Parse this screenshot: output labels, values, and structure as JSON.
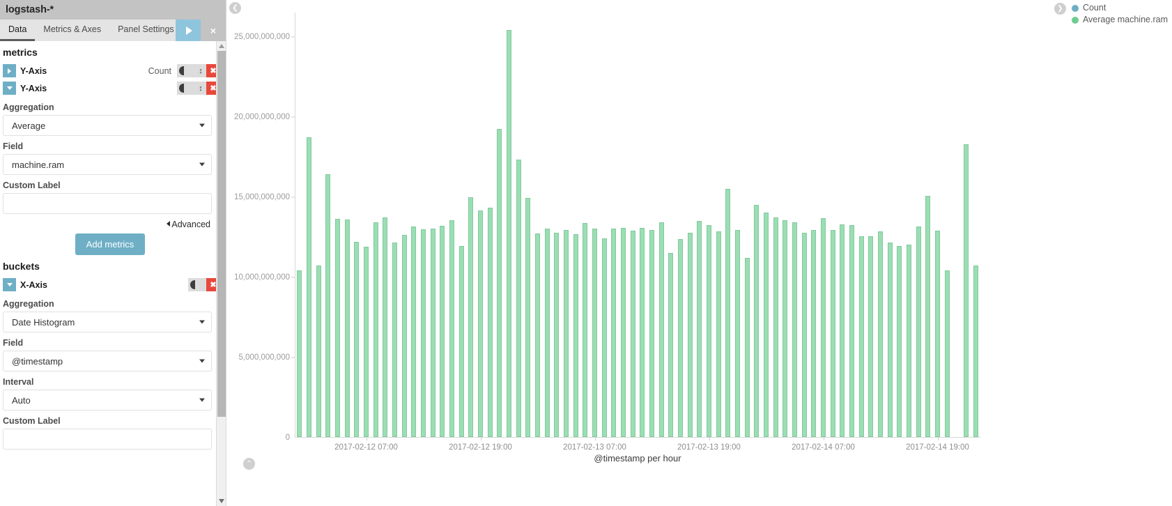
{
  "sidebar": {
    "title": "logstash-*",
    "tabs": [
      {
        "label": "Data",
        "active": true
      },
      {
        "label": "Metrics & Axes",
        "active": false
      },
      {
        "label": "Panel Settings",
        "active": false
      }
    ],
    "apply_icon": "play-icon",
    "discard_icon": "close-icon",
    "discard_label": "×",
    "metrics_heading": "metrics",
    "metrics": [
      {
        "name": "Y-Axis",
        "summary": "Count",
        "collapsed": true,
        "toggle_icon": "visibility-toggle",
        "drag_icon": "drag-handle-icon",
        "remove_icon": "remove-icon",
        "remove_label": "✖"
      },
      {
        "name": "Y-Axis",
        "summary": "",
        "collapsed": false,
        "toggle_icon": "visibility-toggle",
        "drag_icon": "drag-handle-icon",
        "remove_icon": "remove-icon",
        "remove_label": "✖",
        "aggregation_label": "Aggregation",
        "aggregation_value": "Average",
        "field_label": "Field",
        "field_value": "machine.ram",
        "custom_label_label": "Custom Label",
        "custom_label_value": "",
        "advanced_label": "Advanced"
      }
    ],
    "add_metrics_label": "Add metrics",
    "buckets_heading": "buckets",
    "buckets": [
      {
        "name": "X-Axis",
        "collapsed": false,
        "toggle_icon": "visibility-toggle",
        "remove_icon": "remove-icon",
        "remove_label": "✖",
        "aggregation_label": "Aggregation",
        "aggregation_value": "Date Histogram",
        "field_label": "Field",
        "field_value": "@timestamp",
        "interval_label": "Interval",
        "interval_value": "Auto",
        "custom_label_label": "Custom Label",
        "custom_label_value": ""
      }
    ],
    "scrollbar": {
      "up_icon": "scroll-up-arrow",
      "down_icon": "scroll-down-arrow"
    }
  },
  "chart_panel": {
    "collapse_left_icon": "chevron-left-icon",
    "collapse_left_glyph": "❮",
    "collapse_bottom_icon": "chevron-up-icon",
    "collapse_bottom_glyph": "⌃",
    "legend_toggle_icon": "chevron-right-icon",
    "legend_toggle_glyph": "❯"
  },
  "chart_data": {
    "type": "bar",
    "title": "",
    "xlabel": "@timestamp per hour",
    "ylabel": "",
    "ylim": [
      0,
      26500000000
    ],
    "grid": false,
    "legend_position": "top-right",
    "y_ticks": [
      {
        "value": 0,
        "label": "0"
      },
      {
        "value": 5000000000,
        "label": "5,000,000,000"
      },
      {
        "value": 10000000000,
        "label": "10,000,000,000"
      },
      {
        "value": 15000000000,
        "label": "15,000,000,000"
      },
      {
        "value": 20000000000,
        "label": "20,000,000,000"
      },
      {
        "value": 25000000000,
        "label": "25,000,000,000"
      }
    ],
    "x_ticks": [
      {
        "index": 7,
        "label": "2017-02-12 07:00"
      },
      {
        "index": 19,
        "label": "2017-02-12 19:00"
      },
      {
        "index": 31,
        "label": "2017-02-13 07:00"
      },
      {
        "index": 43,
        "label": "2017-02-13 19:00"
      },
      {
        "index": 55,
        "label": "2017-02-14 07:00"
      },
      {
        "index": 67,
        "label": "2017-02-14 19:00"
      }
    ],
    "legend": [
      {
        "name": "Count",
        "color": "#6eafc6"
      },
      {
        "name": "Average machine.ram",
        "color": "#6ecd8f"
      }
    ],
    "series": [
      {
        "name": "Average machine.ram",
        "color": "#7fd6a0",
        "values": [
          10400000000,
          18700000000,
          10700000000,
          16400000000,
          13600000000,
          13550000000,
          12150000000,
          11850000000,
          13400000000,
          13700000000,
          12100000000,
          12600000000,
          13100000000,
          12950000000,
          13000000000,
          13150000000,
          13500000000,
          11900000000,
          14950000000,
          14100000000,
          14300000000,
          19200000000,
          25350000000,
          17300000000,
          14900000000,
          12700000000,
          13000000000,
          12750000000,
          12900000000,
          12650000000,
          13350000000,
          13000000000,
          12400000000,
          13000000000,
          13050000000,
          12850000000,
          13050000000,
          12900000000,
          13400000000,
          11450000000,
          12350000000,
          12750000000,
          13450000000,
          13200000000,
          12800000000,
          15450000000,
          12900000000,
          11150000000,
          14450000000,
          14000000000,
          13700000000,
          13500000000,
          13400000000,
          12750000000,
          12900000000,
          13650000000,
          12900000000,
          13250000000,
          13200000000,
          12500000000,
          12500000000,
          12800000000,
          12100000000,
          11900000000,
          12000000000,
          13100000000,
          15050000000,
          12850000000,
          10400000000,
          0,
          18250000000,
          10700000000
        ]
      }
    ],
    "bar_count": 72,
    "note": "Count series values are near-zero at this y-scale and render as a thin baseline."
  }
}
